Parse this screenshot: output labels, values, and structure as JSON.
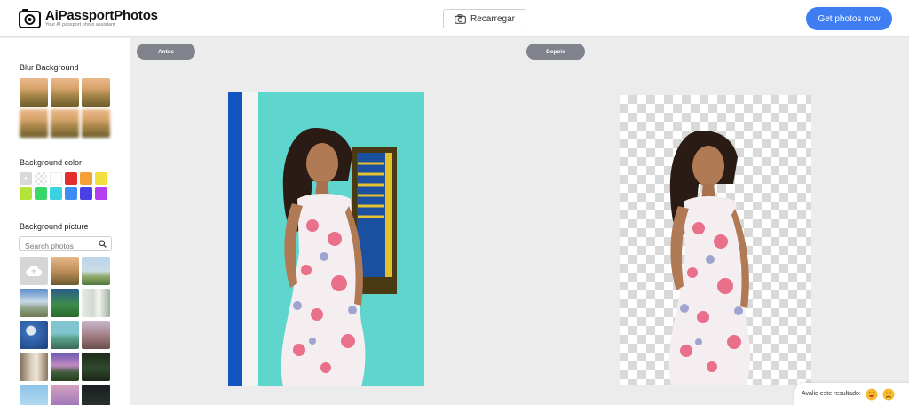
{
  "header": {
    "logo_name": "AiPassportPhotos",
    "logo_tagline": "Your AI passport photo assistant",
    "reload_label": "Recarregar",
    "cta_label": "Get photos now"
  },
  "sidebar": {
    "blur_title": "Blur Background",
    "color_title": "Background color",
    "colors": [
      "#d8d8d8",
      "transparent",
      "#ffffff",
      "#e52d2d",
      "#f5a035",
      "#f3e03c",
      "#b6e33a",
      "#39d66b",
      "#3ad2e0",
      "#3b8cf5",
      "#4a3fe6",
      "#b23ef0"
    ],
    "picture_title": "Background picture",
    "search_placeholder": "Search photos"
  },
  "canvas": {
    "before_label": "Antes",
    "after_label": "Depois"
  },
  "rating": {
    "label": "Avalie este resultado:"
  }
}
